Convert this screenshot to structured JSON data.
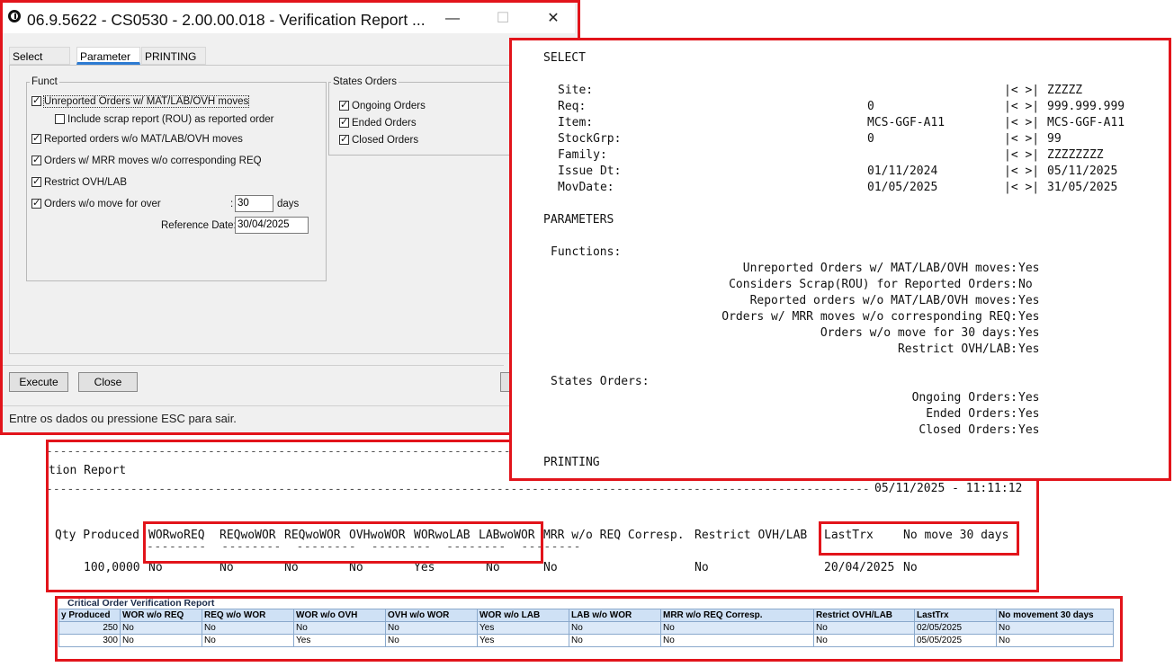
{
  "dialog": {
    "title": "06.9.5622 - CS0530 - 2.00.00.018 - Verification Report ...",
    "window_controls": {
      "minimize": "—",
      "maximize": "☐",
      "close": "✕"
    },
    "tabs": [
      "Select",
      "Parameter",
      "PRINTING"
    ],
    "active_tab": "Parameter",
    "funct_group": {
      "label": "Funct",
      "options": [
        {
          "label": "Unreported Orders w/ MAT/LAB/OVH moves",
          "checked": true
        },
        {
          "label": "Include scrap report (ROU) as reported order",
          "checked": false
        },
        {
          "label": "Reported orders w/o MAT/LAB/OVH moves",
          "checked": true
        },
        {
          "label": "Orders w/ MRR moves w/o corresponding REQ",
          "checked": true
        },
        {
          "label": "Restrict OVH/LAB",
          "checked": true
        },
        {
          "label": "Orders w/o move for over",
          "checked": true
        }
      ],
      "days_colon": ":",
      "days_value": "30",
      "days_label": "days",
      "reference_date_label": "Reference Date:",
      "reference_date_value": "30/04/2025"
    },
    "states_group": {
      "label": "States Orders",
      "options": [
        {
          "label": "Ongoing Orders",
          "checked": true
        },
        {
          "label": "Ended Orders",
          "checked": true
        },
        {
          "label": "Closed Orders",
          "checked": true
        }
      ]
    },
    "buttons": {
      "execute": "Execute",
      "close": "Close"
    },
    "status": "Entre os dados ou pressione ESC para sair."
  },
  "report_panel": {
    "select_heading": "SELECT",
    "select_rows": [
      {
        "label": "Site:",
        "from": "",
        "sep": "|< >|",
        "to": "ZZZZZ"
      },
      {
        "label": "Req:",
        "from": "0",
        "sep": "|< >|",
        "to": "999.999.999"
      },
      {
        "label": "Item:",
        "from": "MCS-GGF-A11",
        "sep": "|< >|",
        "to": "MCS-GGF-A11"
      },
      {
        "label": "StockGrp:",
        "from": "0",
        "sep": "|< >|",
        "to": "99"
      },
      {
        "label": "Family:",
        "from": "",
        "sep": "|< >|",
        "to": "ZZZZZZZZ"
      },
      {
        "label": "Issue Dt:",
        "from": "01/11/2024",
        "sep": "|< >|",
        "to": "05/11/2025"
      },
      {
        "label": "MovDate:",
        "from": "01/05/2025",
        "sep": "|< >|",
        "to": "31/05/2025"
      }
    ],
    "parameters_heading": "PARAMETERS",
    "functions_heading": "Functions:",
    "function_rows": [
      {
        "label": "Unreported Orders w/ MAT/LAB/OVH moves:",
        "value": "Yes"
      },
      {
        "label": "Considers Scrap(ROU) for Reported Orders:",
        "value": "No"
      },
      {
        "label": "Reported orders w/o MAT/LAB/OVH moves:",
        "value": "Yes"
      },
      {
        "label": "Orders w/ MRR moves w/o corresponding REQ:",
        "value": "Yes"
      },
      {
        "label": "Orders w/o move for 30 days:",
        "value": "Yes"
      },
      {
        "label": "Restrict OVH/LAB:",
        "value": "Yes"
      }
    ],
    "states_heading": "States Orders:",
    "state_rows": [
      {
        "label": "Ongoing Orders:",
        "value": "Yes"
      },
      {
        "label": "Ended Orders:",
        "value": "Yes"
      },
      {
        "label": "Closed Orders:",
        "value": "Yes"
      }
    ],
    "printing_heading": "PRINTING"
  },
  "text_strip": {
    "dash_line": "------------------------------------------------------------------------------------------------------------------------------------",
    "title_fragment": "tion Report",
    "datetime": "05/11/2025 - 11:11:12",
    "headers": [
      "Qty Produced",
      "WORwoREQ",
      "REQwoWOR",
      "REQwoWOR",
      "OVHwoWOR",
      "WORwoLAB",
      "LABwoWOR",
      "MRR w/o REQ Corresp.",
      "Restrict OVH/LAB",
      "LastTrx",
      "No move 30 days"
    ],
    "row": [
      "100,0000",
      "No",
      "No",
      "No",
      "No",
      "Yes",
      "No",
      "No",
      "No",
      "20/04/2025",
      "No"
    ]
  },
  "sheet": {
    "title": "Critical Order Verification Report",
    "headers": [
      "y Produced",
      "WOR w/o REQ",
      "REQ w/o WOR",
      "WOR w/o OVH",
      "OVH w/o WOR",
      "WOR w/o LAB",
      "LAB w/o WOR",
      "MRR w/o REQ Corresp.",
      "Restrict OVH/LAB",
      "LastTrx",
      "No movement 30 days"
    ],
    "rows": [
      [
        "250",
        "No",
        "No",
        "No",
        "No",
        "Yes",
        "No",
        "No",
        "No",
        "02/05/2025",
        "No"
      ],
      [
        "300",
        "No",
        "No",
        "Yes",
        "No",
        "Yes",
        "No",
        "No",
        "No",
        "05/05/2025",
        "No"
      ]
    ]
  },
  "colors": {
    "highlight_red": "#e2141b",
    "tab_active": "#2d7bd2",
    "sheet_header": "#cfe1f5",
    "sheet_row": "#dce9f8"
  }
}
